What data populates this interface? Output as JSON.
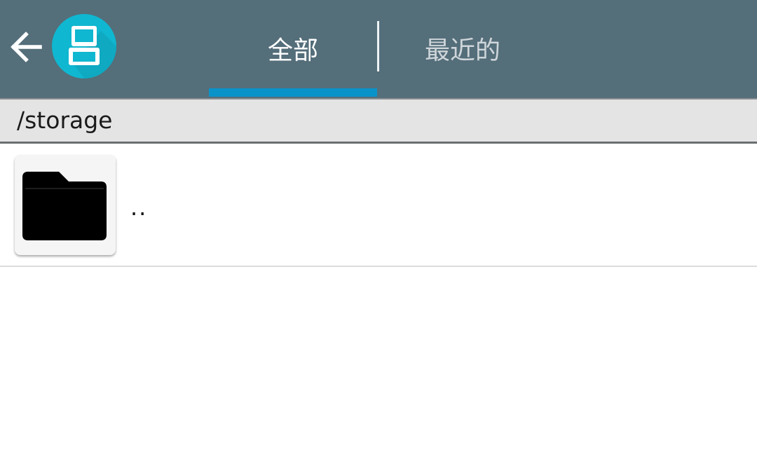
{
  "header": {
    "back_icon": "arrow-left-icon",
    "logo_icon": "dual-screen-console-icon",
    "tabs": [
      {
        "label": "全部",
        "selected": true
      },
      {
        "label": "最近的",
        "selected": false
      }
    ],
    "colors": {
      "toolbar": "#546e7a",
      "indicator": "#0a93c9",
      "logo": "#10b7d0"
    }
  },
  "path_bar": {
    "path": "/storage"
  },
  "files": [
    {
      "name": "..",
      "icon": "folder-icon"
    }
  ]
}
